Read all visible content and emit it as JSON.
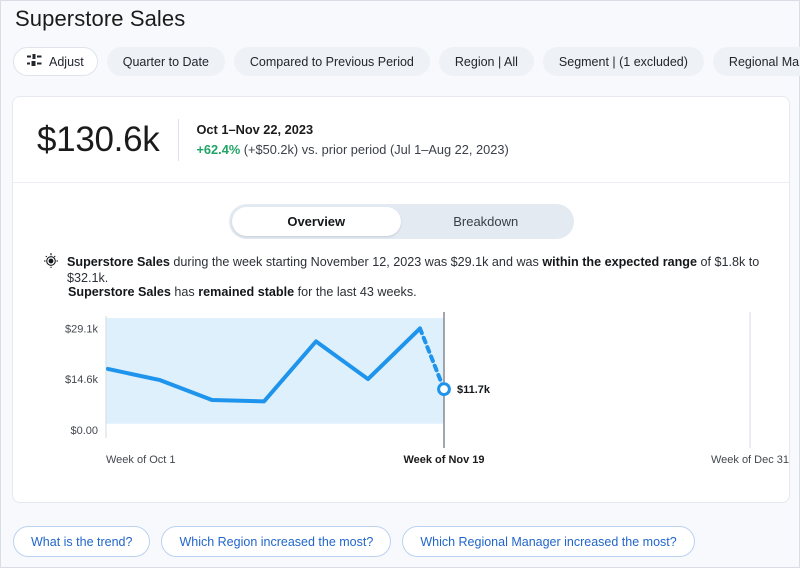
{
  "header": {
    "title": "Superstore Sales"
  },
  "toolbar": {
    "adjust_label": "Adjust",
    "adjust_icon": "sliders-icon",
    "filters": [
      {
        "label": "Quarter to Date"
      },
      {
        "label": "Compared to Previous Period"
      },
      {
        "label": "Region | All"
      },
      {
        "label": "Segment | (1 excluded)"
      },
      {
        "label": "Regional Manager | All"
      }
    ]
  },
  "kpi": {
    "value": "$130.6k",
    "date_range": "Oct 1–Nov 22, 2023",
    "delta_pct": "+62.4%",
    "delta_rest": " (+$50.2k) vs. prior period (Jul 1–Aug 22, 2023)",
    "delta_color": "#21a366"
  },
  "toggle": {
    "options": [
      {
        "label": "Overview",
        "active": true
      },
      {
        "label": "Breakdown",
        "active": false
      }
    ]
  },
  "insights": {
    "icon": "target-icon",
    "line1": {
      "p1": "Superstore Sales",
      "p2": " during the week starting November 12, 2023 was $29.1k and was ",
      "p3": "within the expected range",
      "p4": " of $1.8k to $32.1k."
    },
    "line2": {
      "p1": "Superstore Sales",
      "p2": " has ",
      "p3": "remained stable",
      "p4": " for the last 43 weeks."
    }
  },
  "chart_data": {
    "type": "line",
    "title": "",
    "xlabel": "",
    "ylabel": "",
    "grid": false,
    "legend": "none",
    "accent_color": "#1f94ec",
    "band_color": "#def0fc",
    "ylim": [
      0,
      32100
    ],
    "ytick_labels": [
      "$29.1k",
      "$14.6k",
      "$0.00"
    ],
    "ytick_values": [
      29100,
      14600,
      0
    ],
    "xtick_labels": [
      "Week of Oct 1",
      "Week of Nov 19",
      "Week of Dec 31"
    ],
    "expected_range": {
      "lower": 1800,
      "upper": 32100,
      "lower_label": "$1.8k",
      "upper_label": "$32.1k"
    },
    "series": [
      {
        "name": "Superstore Sales (actual)",
        "style": "solid",
        "x": [
          "Oct 1",
          "Oct 8",
          "Oct 15",
          "Oct 22",
          "Oct 29",
          "Nov 5",
          "Nov 12"
        ],
        "values": [
          17500,
          14300,
          8600,
          8200,
          25400,
          14600,
          29100
        ]
      },
      {
        "name": "Superstore Sales (forecast)",
        "style": "dashed",
        "x": [
          "Nov 12",
          "Nov 19"
        ],
        "values": [
          29100,
          11700
        ]
      }
    ],
    "endpoint": {
      "label": "$11.7k",
      "value": 11700,
      "x": "Week of Nov 19",
      "marker": "hollow-circle"
    }
  },
  "chips": [
    {
      "label": "What is the trend?"
    },
    {
      "label": "Which Region increased the most?"
    },
    {
      "label": "Which Regional Manager increased the most?"
    }
  ]
}
